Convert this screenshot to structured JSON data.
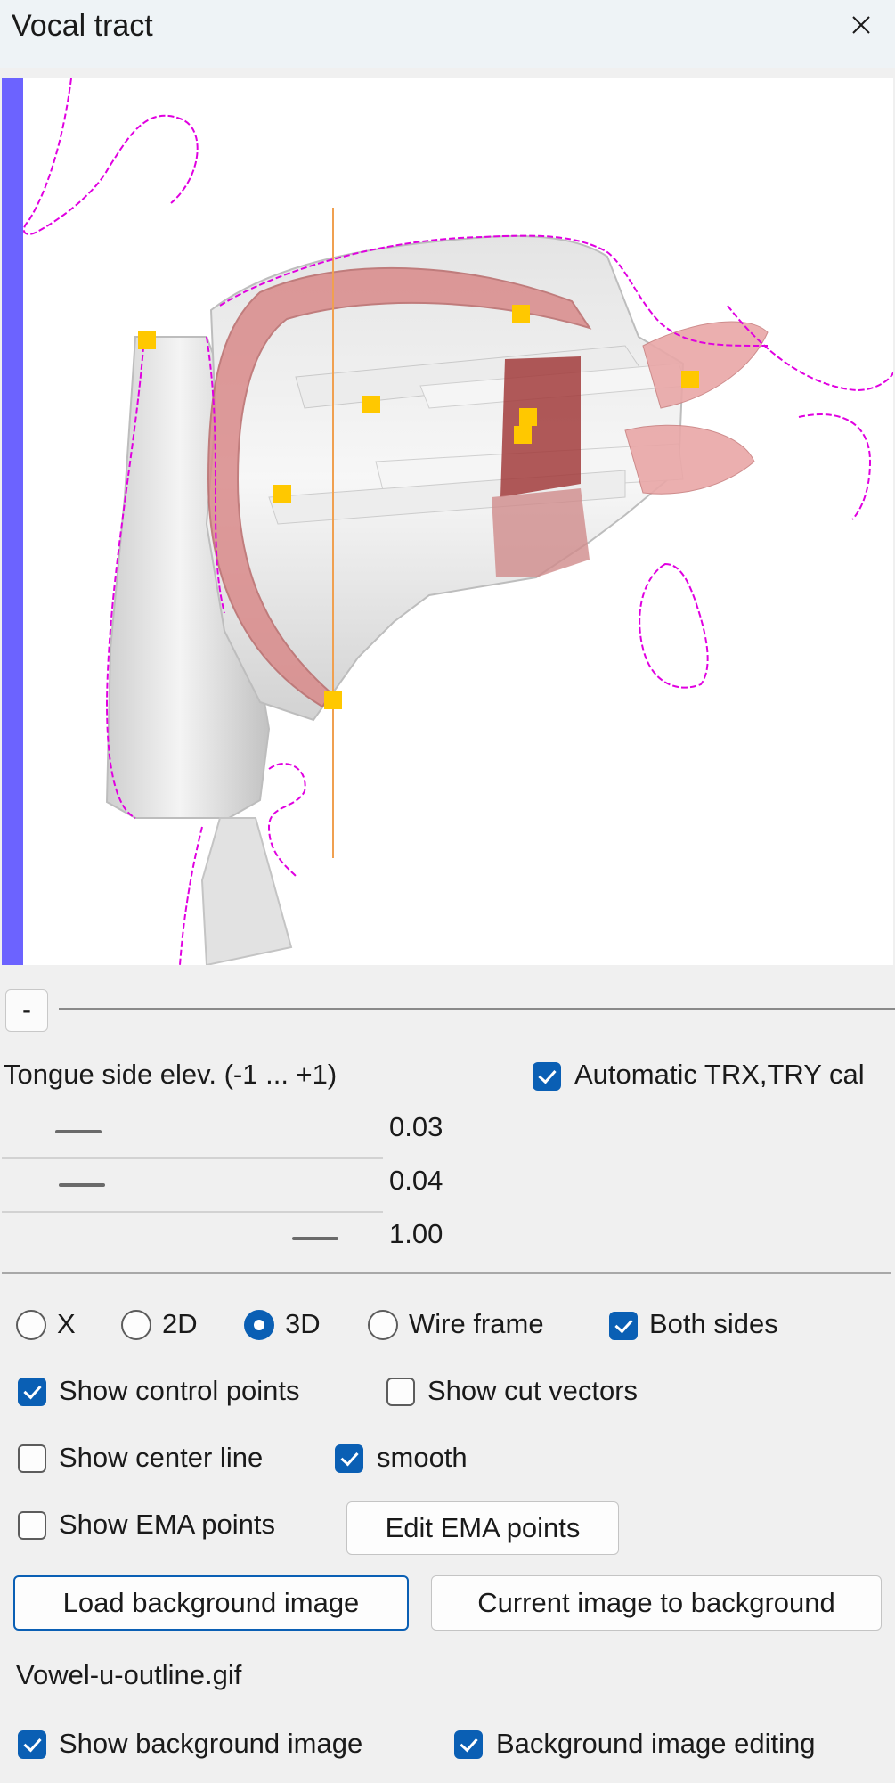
{
  "window": {
    "title": "Vocal tract"
  },
  "toolbar": {
    "minus_label": "-"
  },
  "params": {
    "tongue_side_label": "Tongue side elev. (-1 ... +1)",
    "auto_trx_label": "Automatic TRX,TRY cal",
    "auto_trx_checked": true,
    "sliders": [
      {
        "value_text": "0.03",
        "value": 0.03
      },
      {
        "value_text": "0.04",
        "value": 0.04
      },
      {
        "value_text": "1.00",
        "value": 1.0
      }
    ]
  },
  "view_mode": {
    "options": [
      "X",
      "2D",
      "3D",
      "Wire frame"
    ],
    "selected": "3D",
    "both_sides_label": "Both sides",
    "both_sides_checked": true
  },
  "options": {
    "show_control_points": "Show control points",
    "show_control_points_checked": true,
    "show_cut_vectors": "Show cut vectors",
    "show_cut_vectors_checked": false,
    "show_center_line": "Show center line",
    "show_center_line_checked": false,
    "smooth": "smooth",
    "smooth_checked": true,
    "show_ema_points": "Show EMA points",
    "show_ema_points_checked": false,
    "edit_ema_points": "Edit EMA points"
  },
  "background": {
    "load_button": "Load background image",
    "current_button": "Current image to background",
    "file_name": "Vowel-u-outline.gif",
    "show_bg_label": "Show background image",
    "show_bg_checked": true,
    "bg_editing_label": "Background image editing",
    "bg_editing_checked": true
  },
  "colors": {
    "accent": "#0a5fb4",
    "control_point": "#ffc800",
    "outline": "#e000e0",
    "center_line": "#f0a050",
    "tongue": "#d98a8a",
    "side_bar": "#6c63ff"
  }
}
